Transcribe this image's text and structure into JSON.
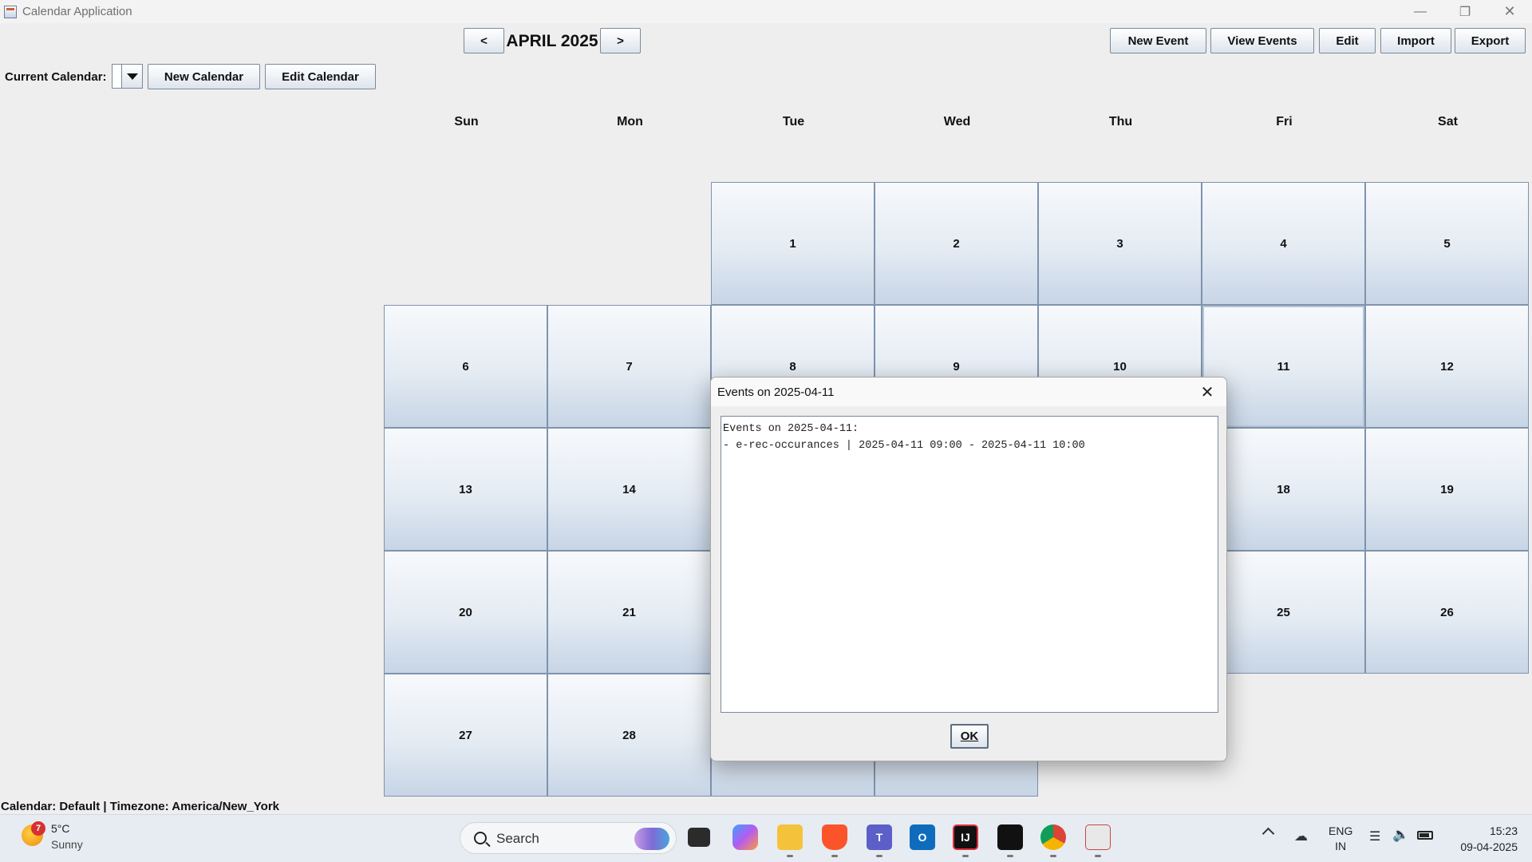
{
  "window": {
    "title": "Calendar Application"
  },
  "nav": {
    "prev": "<",
    "month": "APRIL 2025",
    "next": ">"
  },
  "toolbar": {
    "new_event": "New Event",
    "view_events": "View Events",
    "edit": "Edit",
    "import": "Import",
    "export": "Export"
  },
  "calendar_bar": {
    "label": "Current Calendar:",
    "selected": "",
    "new_calendar": "New Calendar",
    "edit_calendar": "Edit Calendar"
  },
  "weekdays": [
    "Sun",
    "Mon",
    "Tue",
    "Wed",
    "Thu",
    "Fri",
    "Sat"
  ],
  "days": [
    "1",
    "2",
    "3",
    "4",
    "5",
    "6",
    "7",
    "8",
    "9",
    "10",
    "11",
    "12",
    "13",
    "14",
    "18",
    "19",
    "20",
    "21",
    "25",
    "26",
    "27",
    "28"
  ],
  "selected_day": "11",
  "status": "Calendar: Default | Timezone: America/New_York",
  "dialog": {
    "title": "Events on 2025-04-11",
    "lines": [
      "Events on 2025-04-11:",
      "- e-rec-occurances | 2025-04-11 09:00 - 2025-04-11 10:00"
    ],
    "ok": "OK"
  },
  "taskbar": {
    "weather_badge": "7",
    "temperature": "5°C",
    "condition": "Sunny",
    "search_placeholder": "Search",
    "language": "ENG",
    "region": "IN",
    "time": "15:23",
    "date": "09-04-2025"
  }
}
